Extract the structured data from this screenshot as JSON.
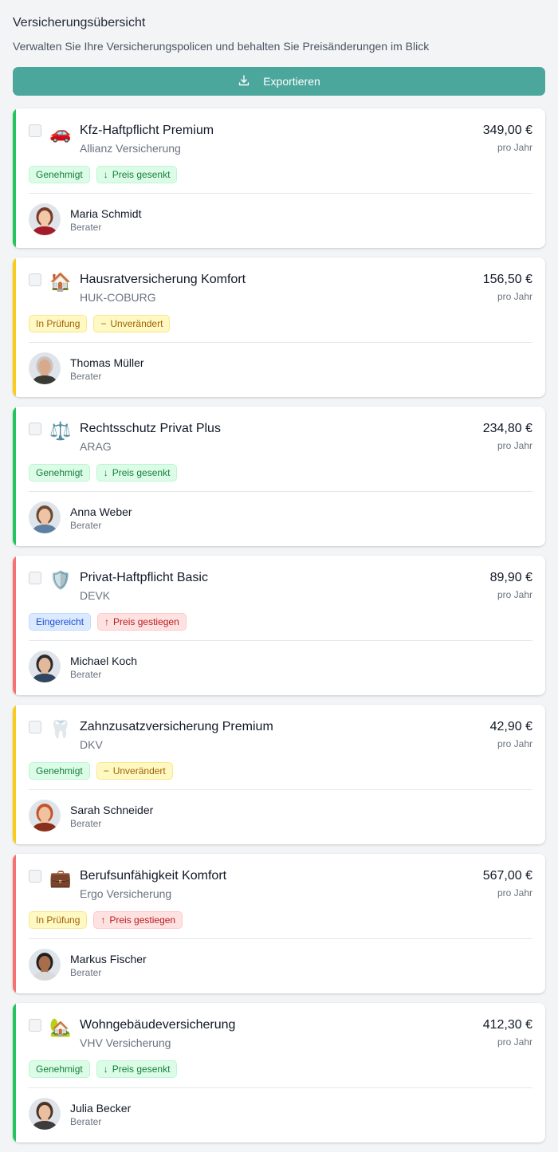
{
  "header": {
    "title": "Versicherungsübersicht",
    "subtitle": "Verwalten Sie Ihre Versicherungspolicen und behalten Sie Preisänderungen im Blick",
    "export_label": "Exportieren"
  },
  "colors": {
    "accent_green": "#22c55e",
    "accent_yellow": "#facc15",
    "accent_red": "#f87171",
    "button": "#4ba69c"
  },
  "policies": [
    {
      "name": "Kfz-Haftpflicht Premium",
      "insurer": "Allianz Versicherung",
      "price": "349,00 €",
      "period": "pro Jahr",
      "icon": "🚗",
      "icon_name": "car-icon",
      "accent": "green",
      "status": "Genehmigt",
      "status_kind": "green",
      "change": "Preis gesenkt",
      "change_kind": "down",
      "advisor": "Maria Schmidt",
      "role": "Berater",
      "avatar_colors": [
        "#7a3b2e",
        "#f2c9a8",
        "#a31c2c"
      ]
    },
    {
      "name": "Hausratversicherung Komfort",
      "insurer": "HUK-COBURG",
      "price": "156,50 €",
      "period": "pro Jahr",
      "icon": "🏠",
      "icon_name": "house-icon",
      "accent": "yellow",
      "status": "In Prüfung",
      "status_kind": "yellow",
      "change": "Unverändert",
      "change_kind": "same",
      "advisor": "Thomas Müller",
      "role": "Berater",
      "avatar_colors": [
        "#c9c3bb",
        "#d8a98a",
        "#3a3a34"
      ]
    },
    {
      "name": "Rechtsschutz Privat Plus",
      "insurer": "ARAG",
      "price": "234,80 €",
      "period": "pro Jahr",
      "icon": "⚖️",
      "icon_name": "scales-icon",
      "accent": "green",
      "status": "Genehmigt",
      "status_kind": "green",
      "change": "Preis gesenkt",
      "change_kind": "down",
      "advisor": "Anna Weber",
      "role": "Berater",
      "avatar_colors": [
        "#6b4a33",
        "#efc4a6",
        "#5d7fa3"
      ]
    },
    {
      "name": "Privat-Haftpflicht Basic",
      "insurer": "DEVK",
      "price": "89,90 €",
      "period": "pro Jahr",
      "icon": "🛡️",
      "icon_name": "shield-icon",
      "accent": "red",
      "status": "Eingereicht",
      "status_kind": "blue",
      "change": "Preis gestiegen",
      "change_kind": "up",
      "advisor": "Michael Koch",
      "role": "Berater",
      "avatar_colors": [
        "#2b2b2b",
        "#e3b99b",
        "#304560"
      ]
    },
    {
      "name": "Zahnzusatzversicherung Premium",
      "insurer": "DKV",
      "price": "42,90 €",
      "period": "pro Jahr",
      "icon": "🦷",
      "icon_name": "tooth-icon",
      "accent": "yellow",
      "status": "Genehmigt",
      "status_kind": "green",
      "change": "Unverändert",
      "change_kind": "same",
      "advisor": "Sarah Schneider",
      "role": "Berater",
      "avatar_colors": [
        "#c2552b",
        "#f0c2a0",
        "#8a2f1b"
      ]
    },
    {
      "name": "Berufsunfähigkeit Komfort",
      "insurer": "Ergo Versicherung",
      "price": "567,00 €",
      "period": "pro Jahr",
      "icon": "💼",
      "icon_name": "briefcase-icon",
      "accent": "red",
      "status": "In Prüfung",
      "status_kind": "yellow",
      "change": "Preis gestiegen",
      "change_kind": "up",
      "advisor": "Markus Fischer",
      "role": "Berater",
      "avatar_colors": [
        "#1f1f1f",
        "#a86e4c",
        "#d9d9d9"
      ]
    },
    {
      "name": "Wohngebäudeversicherung",
      "insurer": "VHV Versicherung",
      "price": "412,30 €",
      "period": "pro Jahr",
      "icon": "🏡",
      "icon_name": "house-with-garden-icon",
      "accent": "green",
      "status": "Genehmigt",
      "status_kind": "green",
      "change": "Preis gesenkt",
      "change_kind": "down",
      "advisor": "Julia Becker",
      "role": "Berater",
      "avatar_colors": [
        "#4a3326",
        "#e9bfa0",
        "#3d3d3d"
      ]
    }
  ]
}
